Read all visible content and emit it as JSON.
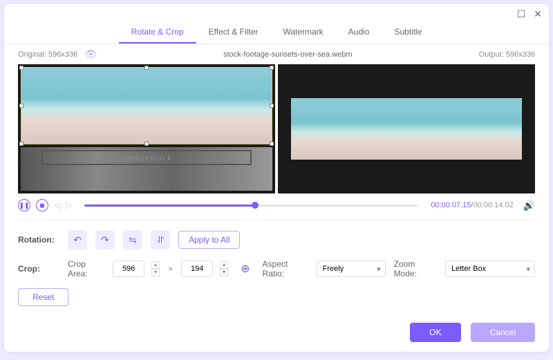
{
  "window": {
    "maximize": "☐",
    "close": "✕"
  },
  "tabs": [
    "Rotate & Crop",
    "Effect & Filter",
    "Watermark",
    "Audio",
    "Subtitle"
  ],
  "activeTab": 0,
  "info": {
    "original": "Original: 596x336",
    "filename": "stock-footage-sunsets-over-sea.webm",
    "output": "Output: 596x336"
  },
  "watermark_text": "shutterstock",
  "playback": {
    "current": "00:00:07.15",
    "total": "/00:00:14.02"
  },
  "rotation": {
    "label": "Rotation:",
    "apply": "Apply to All"
  },
  "crop": {
    "label": "Crop:",
    "area_label": "Crop Area:",
    "width": "596",
    "height": "194",
    "aspect_label": "Aspect Ratio:",
    "aspect_value": "Freely",
    "zoom_label": "Zoom Mode:",
    "zoom_value": "Letter Box",
    "reset": "Reset"
  },
  "footer": {
    "ok": "OK",
    "cancel": "Cancel"
  }
}
